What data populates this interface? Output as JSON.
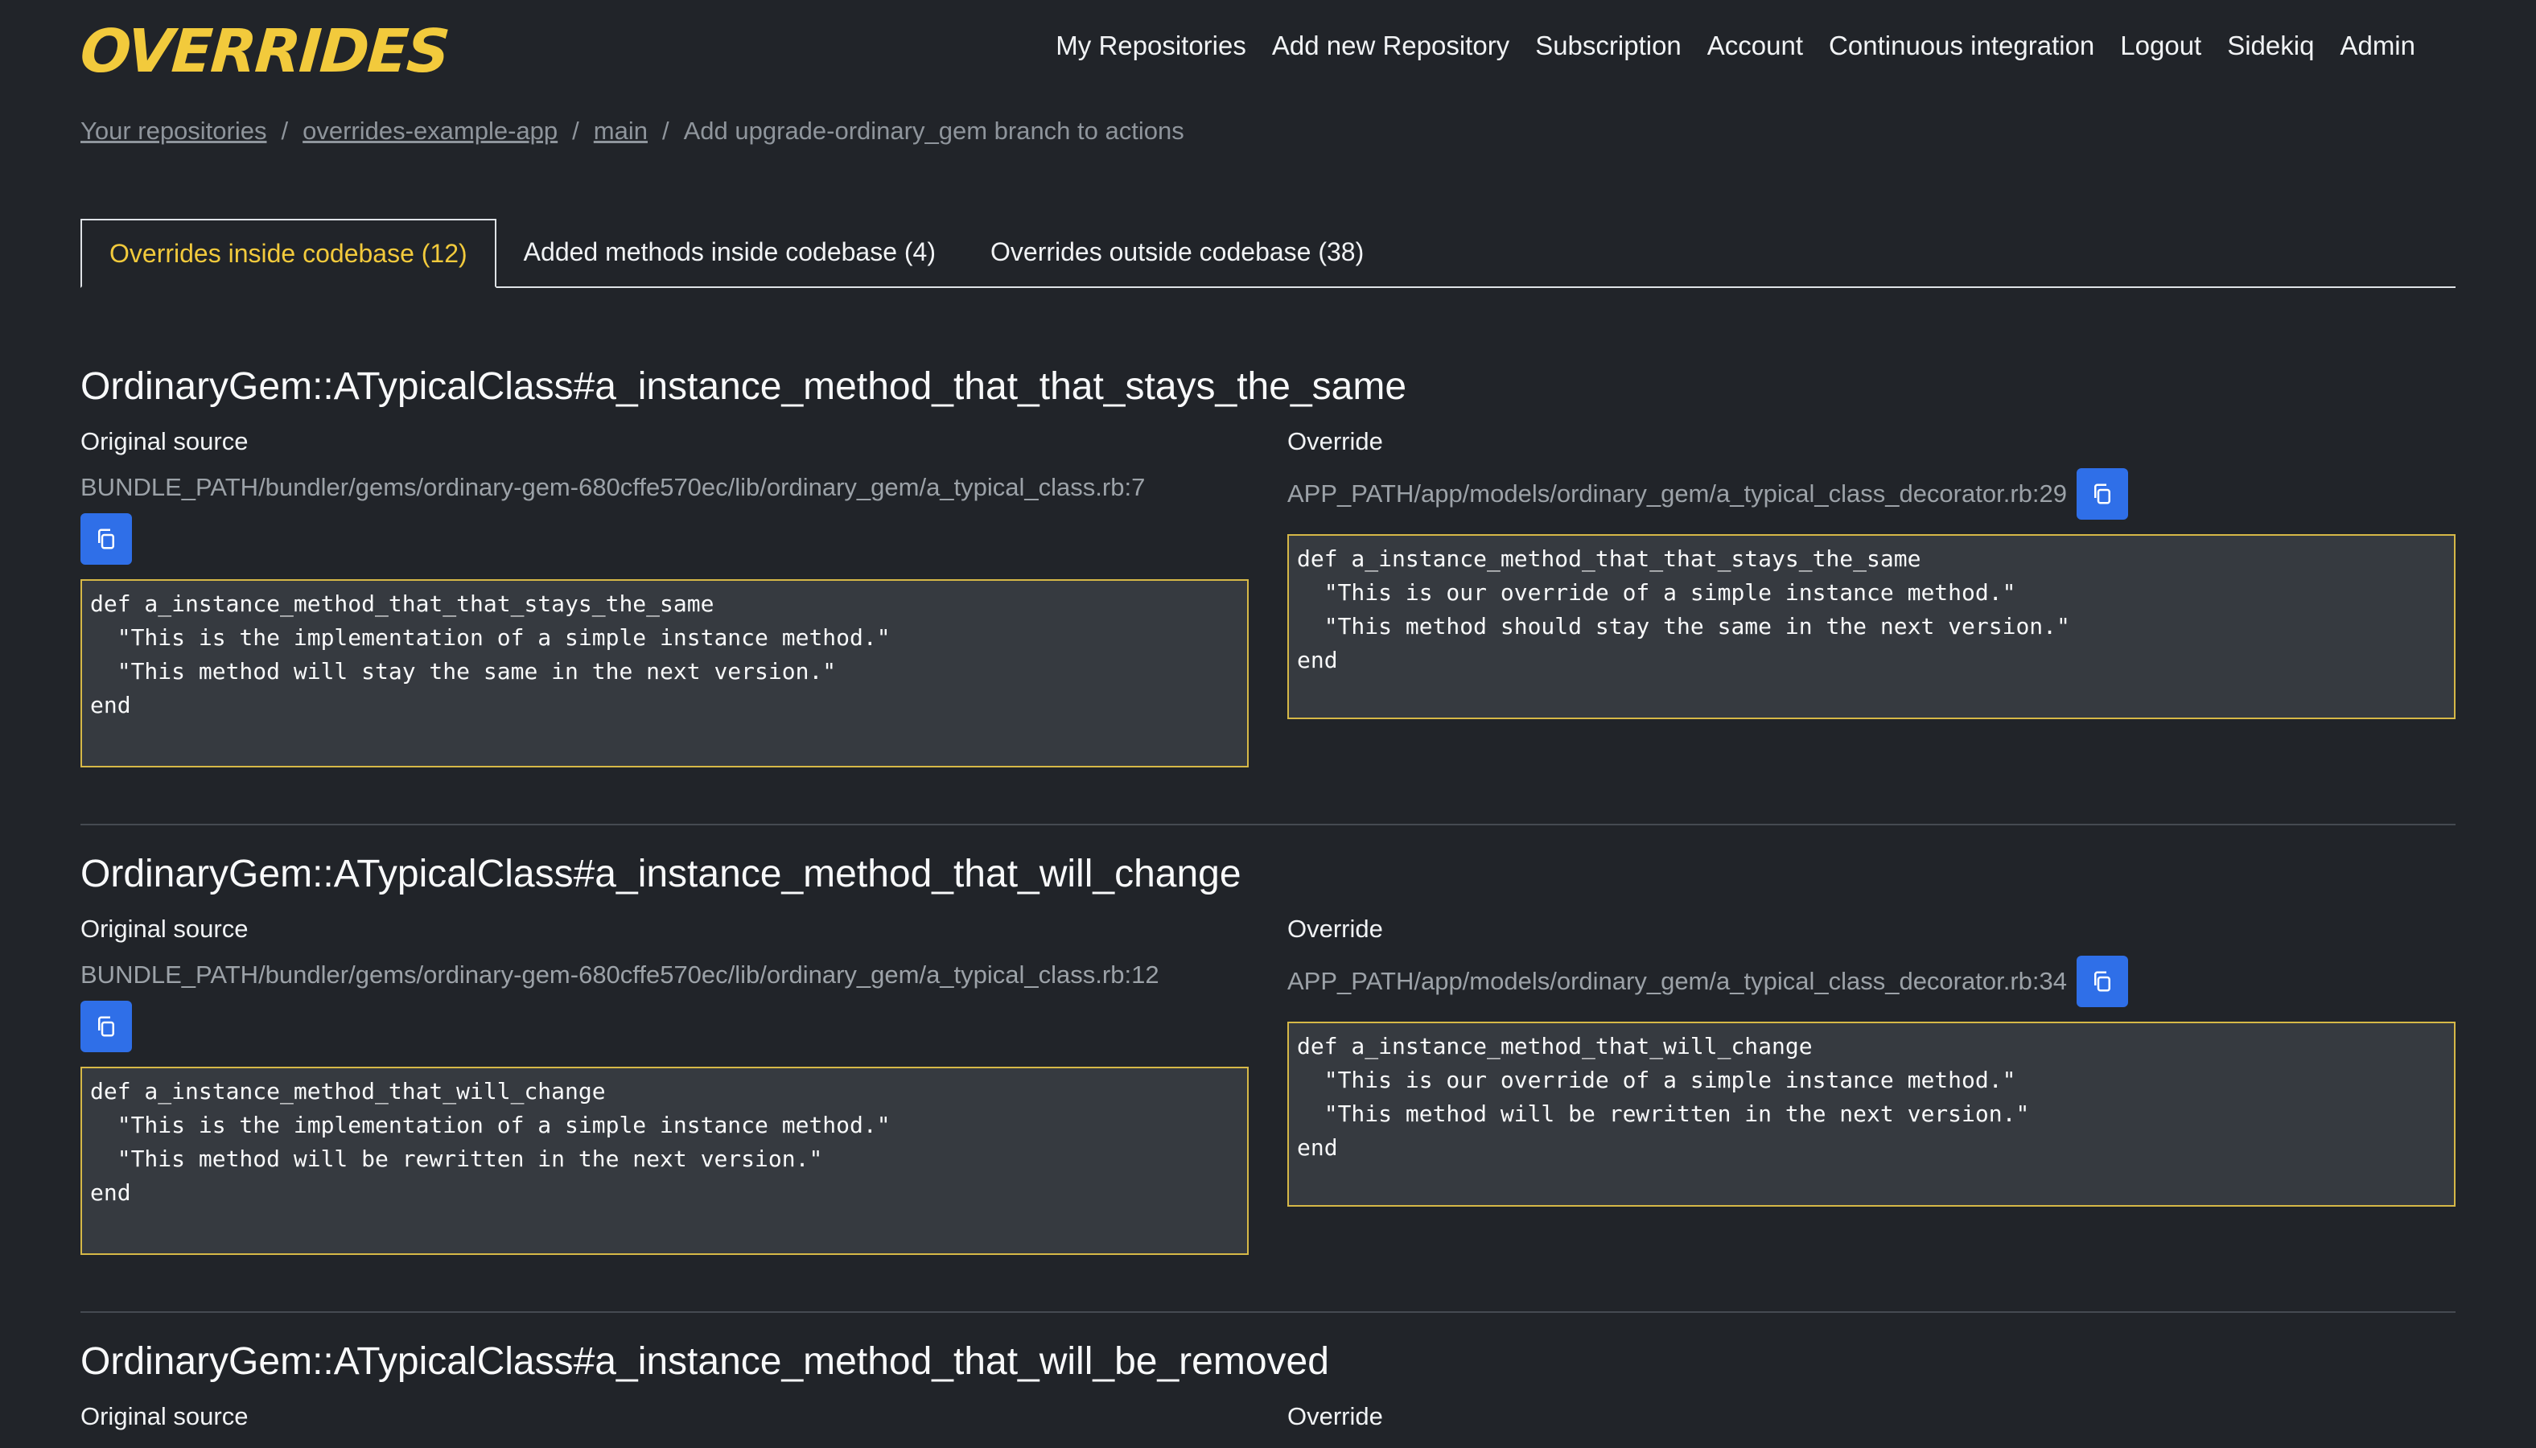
{
  "header": {
    "logo": "OVERRIDES",
    "nav": [
      "My Repositories",
      "Add new Repository",
      "Subscription",
      "Account",
      "Continuous integration",
      "Logout",
      "Sidekiq",
      "Admin"
    ]
  },
  "breadcrumb": {
    "items": [
      "Your repositories",
      "overrides-example-app",
      "main"
    ],
    "current": "Add upgrade-ordinary_gem branch to actions",
    "separator": "/"
  },
  "tabs": [
    {
      "label": "Overrides inside codebase (12)",
      "active": true
    },
    {
      "label": "Added methods inside codebase (4)",
      "active": false
    },
    {
      "label": "Overrides outside codebase (38)",
      "active": false
    }
  ],
  "labels": {
    "original": "Original source",
    "override": "Override"
  },
  "sections": [
    {
      "title": "OrdinaryGem::ATypicalClass#a_instance_method_that_that_stays_the_same",
      "original_path": "BUNDLE_PATH/bundler/gems/ordinary-gem-680cffe570ec/lib/ordinary_gem/a_typical_class.rb:7",
      "original_code": "def a_instance_method_that_that_stays_the_same\n  \"This is the implementation of a simple instance method.\"\n  \"This method will stay the same in the next version.\"\nend",
      "override_path": "APP_PATH/app/models/ordinary_gem/a_typical_class_decorator.rb:29",
      "override_code": "def a_instance_method_that_that_stays_the_same\n  \"This is our override of a simple instance method.\"\n  \"This method should stay the same in the next version.\"\nend"
    },
    {
      "title": "OrdinaryGem::ATypicalClass#a_instance_method_that_will_change",
      "original_path": "BUNDLE_PATH/bundler/gems/ordinary-gem-680cffe570ec/lib/ordinary_gem/a_typical_class.rb:12",
      "original_code": "def a_instance_method_that_will_change\n  \"This is the implementation of a simple instance method.\"\n  \"This method will be rewritten in the next version.\"\nend",
      "override_path": "APP_PATH/app/models/ordinary_gem/a_typical_class_decorator.rb:34",
      "override_code": "def a_instance_method_that_will_change\n  \"This is our override of a simple instance method.\"\n  \"This method will be rewritten in the next version.\"\nend"
    },
    {
      "title": "OrdinaryGem::ATypicalClass#a_instance_method_that_will_be_removed"
    }
  ],
  "colors": {
    "background": "#212429",
    "accent": "#f2ca3c",
    "button": "#2f6fe8",
    "code_border": "#d6b847"
  },
  "icons": {
    "copy": "copy-icon"
  }
}
